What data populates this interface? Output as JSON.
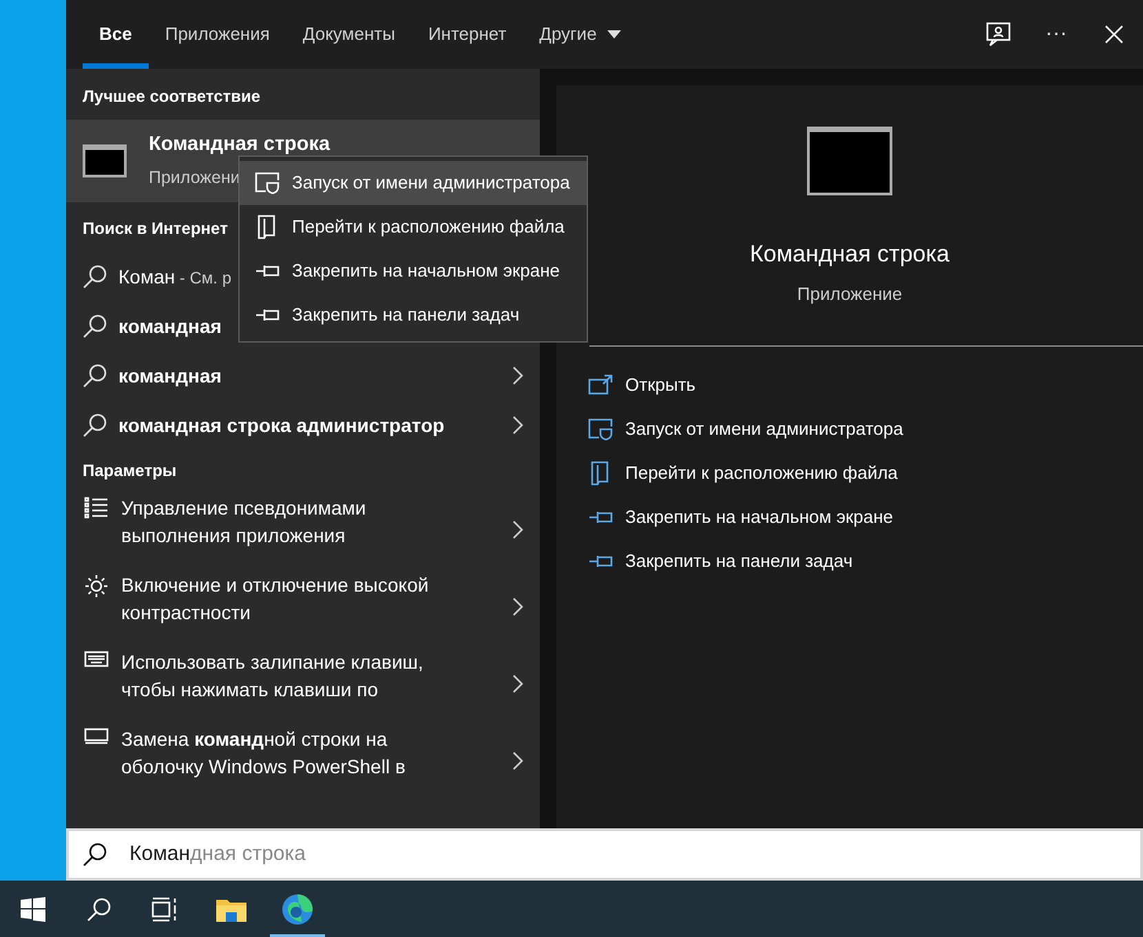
{
  "tabs": [
    {
      "label": "Все",
      "selected": true,
      "dropdown": false
    },
    {
      "label": "Приложения",
      "selected": false,
      "dropdown": false
    },
    {
      "label": "Документы",
      "selected": false,
      "dropdown": false
    },
    {
      "label": "Интернет",
      "selected": false,
      "dropdown": false
    },
    {
      "label": "Другие",
      "selected": false,
      "dropdown": true
    }
  ],
  "header_buttons": [
    {
      "kind": "feedback"
    },
    {
      "kind": "more",
      "label": "···"
    },
    {
      "kind": "close"
    }
  ],
  "best_match": {
    "heading": "Лучшее соответствие",
    "title": "Командная строка",
    "subtitle": "Приложени",
    "selected": true
  },
  "web_search": {
    "heading": "Поиск в Интернет",
    "items": [
      {
        "text": "Коман",
        "note": " - См. р",
        "bold": false
      },
      {
        "text": "командная",
        "bold": true
      },
      {
        "text": "командная",
        "bold": true,
        "arrow": true
      },
      {
        "text": "командная строка администратор",
        "bold": true,
        "arrow": true
      }
    ]
  },
  "settings": {
    "heading": "Параметры",
    "items": [
      {
        "kind": "list",
        "lines": [
          "Управление псевдонимами",
          "выполнения приложения"
        ]
      },
      {
        "kind": "brightness",
        "lines": [
          "Включение и отключение высокой",
          "контрастности"
        ]
      },
      {
        "kind": "keyboard",
        "lines": [
          "Использовать залипание клавиш,",
          "чтобы нажимать клавиши по"
        ]
      },
      {
        "kind": "screen",
        "lines": [
          "Замена **команд**ной строки на",
          "оболочку Windows PowerShell в"
        ]
      }
    ]
  },
  "context_menu": [
    {
      "kind": "admin",
      "label": "Запуск от имени администратора",
      "selected": true
    },
    {
      "kind": "folder",
      "label": "Перейти к расположению файла",
      "selected": false
    },
    {
      "kind": "pin",
      "label": "Закрепить на начальном экране",
      "selected": false
    },
    {
      "kind": "pin",
      "label": "Закрепить на панели задач",
      "selected": false
    }
  ],
  "preview": {
    "title": "Командная строка",
    "subtitle": "Приложение",
    "actions": [
      {
        "kind": "open",
        "label": "Открыть"
      },
      {
        "kind": "admin",
        "label": "Запуск от имени администратора"
      },
      {
        "kind": "folder",
        "label": "Перейти к расположению файла"
      },
      {
        "kind": "pin",
        "label": "Закрепить на начальном экране"
      },
      {
        "kind": "pin",
        "label": "Закрепить на панели задач"
      }
    ]
  },
  "search": {
    "value": "Коман",
    "suggestion": "дная строка"
  },
  "taskbar": [
    {
      "kind": "start",
      "active": false
    },
    {
      "kind": "search",
      "active": false
    },
    {
      "kind": "taskview",
      "active": false
    },
    {
      "kind": "explorer",
      "active": false
    },
    {
      "kind": "edge",
      "active": true
    }
  ]
}
